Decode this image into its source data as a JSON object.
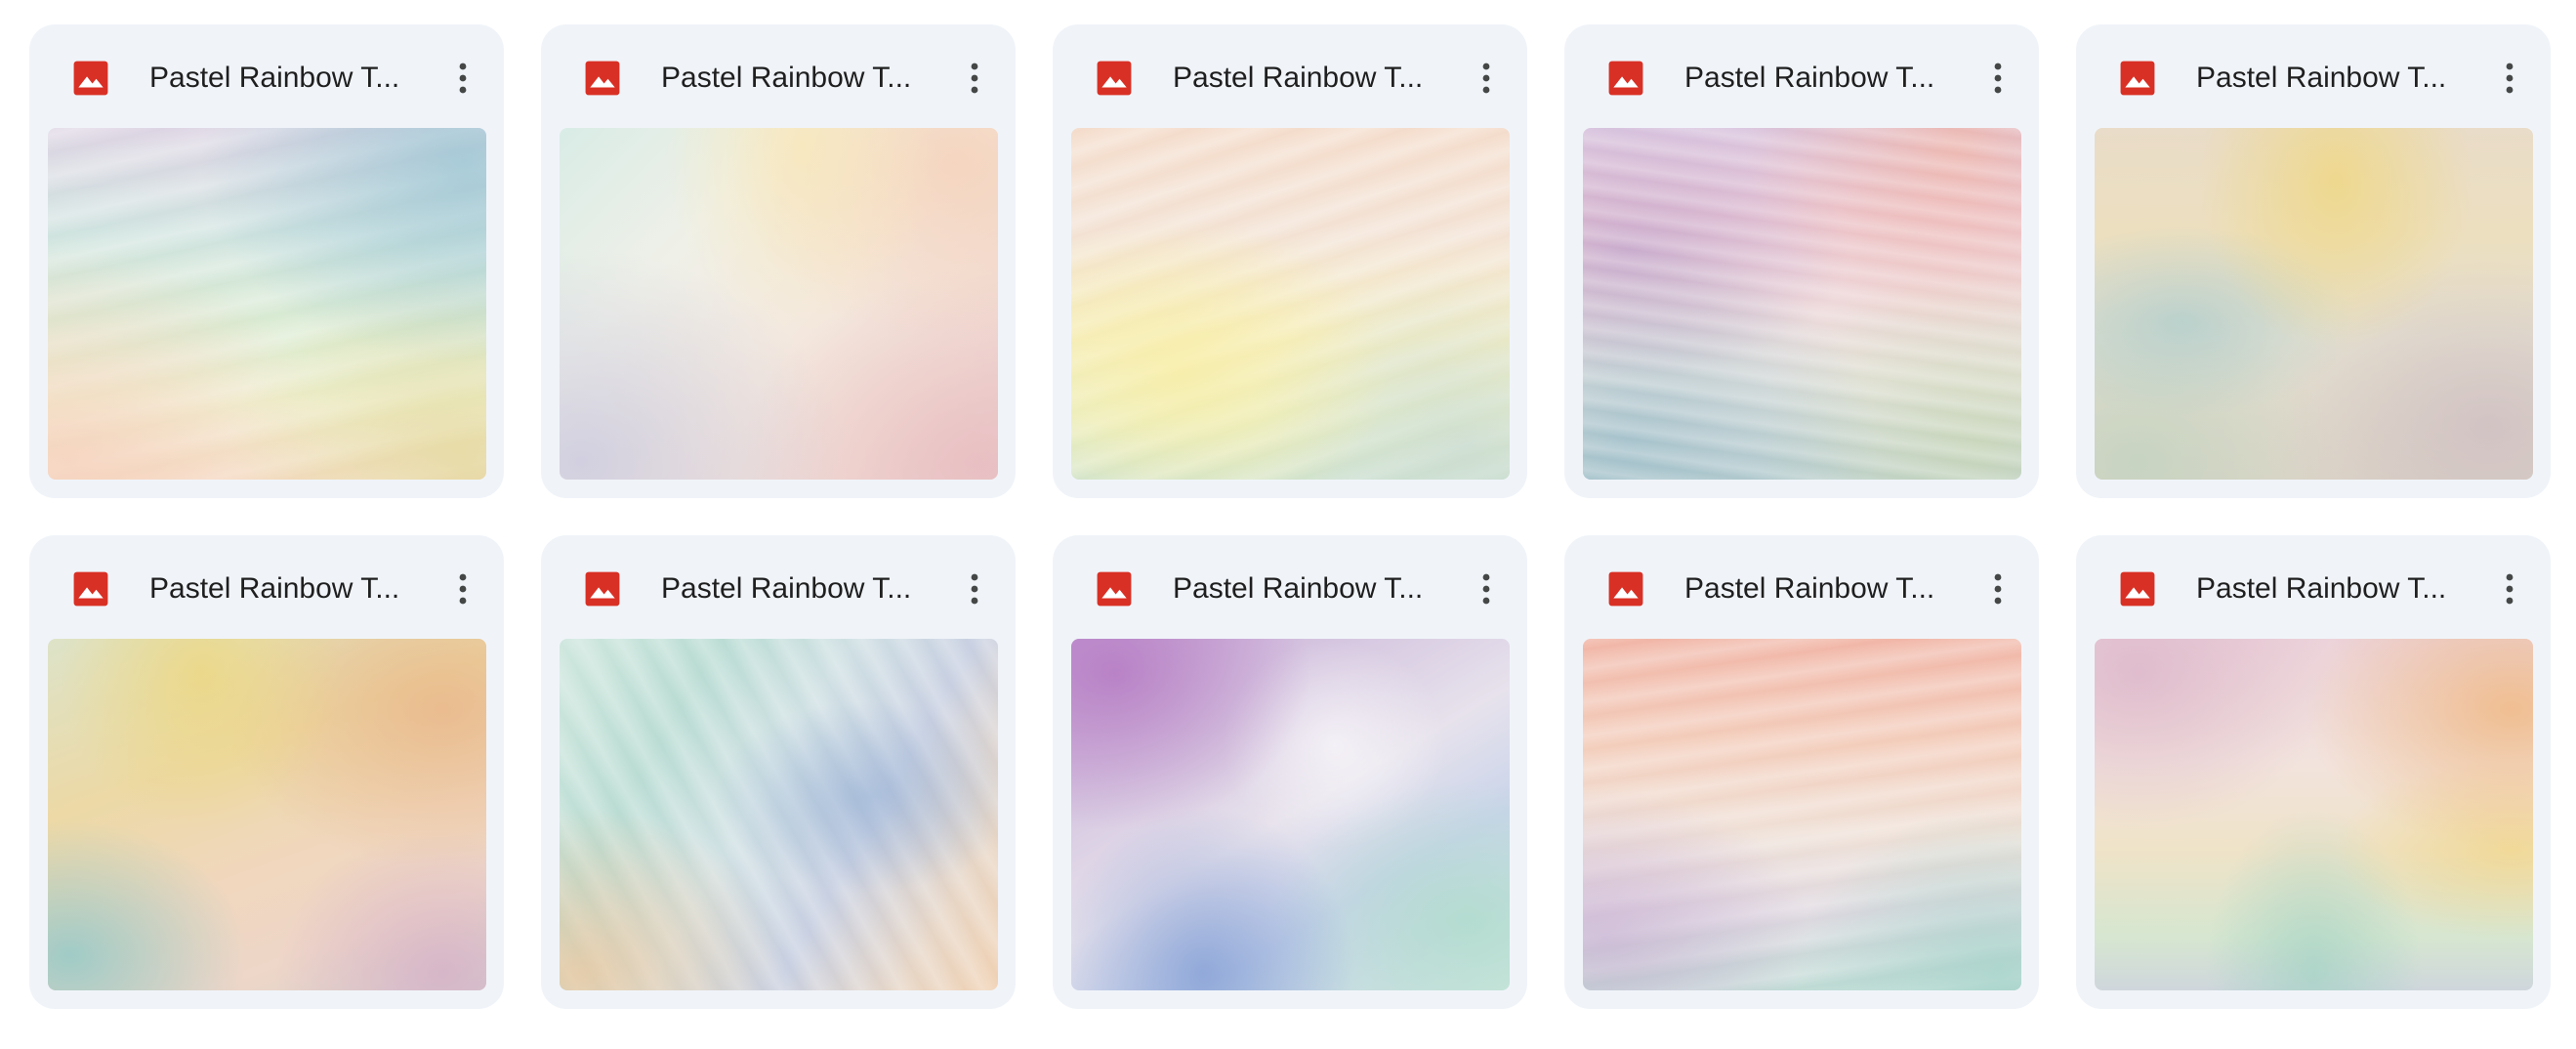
{
  "colors": {
    "card_background": "#f0f4f9",
    "image_icon_red": "#d93025",
    "text": "#1f1f1f",
    "more_icon": "#444746"
  },
  "icons": {
    "file_type": "image-file-icon",
    "more": "more-vert-icon"
  },
  "files": [
    {
      "name": "Pastel Rainbow T..."
    },
    {
      "name": "Pastel Rainbow T..."
    },
    {
      "name": "Pastel Rainbow T..."
    },
    {
      "name": "Pastel Rainbow T..."
    },
    {
      "name": "Pastel Rainbow T..."
    },
    {
      "name": "Pastel Rainbow T..."
    },
    {
      "name": "Pastel Rainbow T..."
    },
    {
      "name": "Pastel Rainbow T..."
    },
    {
      "name": "Pastel Rainbow T..."
    },
    {
      "name": "Pastel Rainbow T..."
    }
  ]
}
